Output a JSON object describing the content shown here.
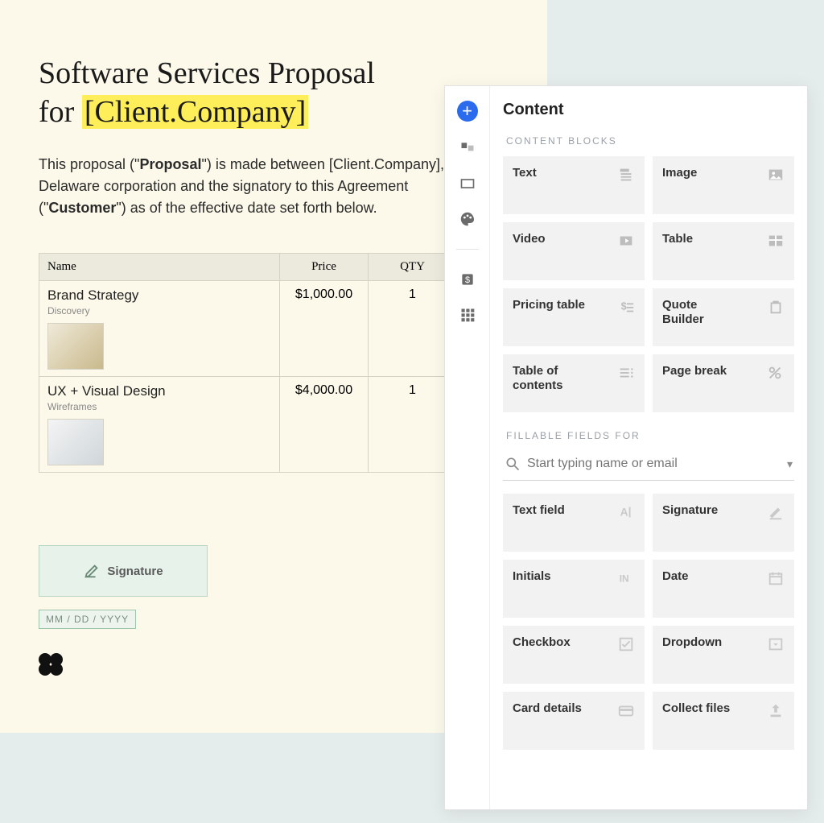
{
  "document": {
    "title_line1": "Software Services Proposal",
    "title_line2_prefix": "for ",
    "title_token": "[Client.Company]",
    "body_parts": {
      "p1a": "This proposal (\"",
      "p1b": "Proposal",
      "p1c": "\") is made between [Client.Company], a Delaware corporation and the signatory to this Agreement (\"",
      "p1d": "Customer",
      "p1e": "\") as of the effective date set forth below."
    },
    "table": {
      "headers": {
        "name": "Name",
        "price": "Price",
        "qty": "QTY"
      },
      "rows": [
        {
          "name": "Brand Strategy",
          "sub": "Discovery",
          "price": "$1,000.00",
          "qty": "1"
        },
        {
          "name": "UX + Visual Design",
          "sub": "Wireframes",
          "price": "$4,000.00",
          "qty": "1"
        }
      ]
    },
    "signature_label": "Signature",
    "date_placeholder": "MM / DD / YYYY"
  },
  "panel": {
    "title": "Content",
    "sections": {
      "blocks_label": "CONTENT BLOCKS",
      "fields_label": "FILLABLE FIELDS FOR"
    },
    "search_placeholder": "Start typing name or email",
    "content_blocks": [
      {
        "label": "Text",
        "icon": "text"
      },
      {
        "label": "Image",
        "icon": "image"
      },
      {
        "label": "Video",
        "icon": "video"
      },
      {
        "label": "Table",
        "icon": "table"
      },
      {
        "label": "Pricing table",
        "icon": "pricing"
      },
      {
        "label": "Quote Builder",
        "icon": "quote"
      },
      {
        "label": "Table of contents",
        "icon": "toc"
      },
      {
        "label": "Page break",
        "icon": "pagebreak"
      }
    ],
    "fillable_fields": [
      {
        "label": "Text field",
        "icon": "textfield"
      },
      {
        "label": "Signature",
        "icon": "signature"
      },
      {
        "label": "Initials",
        "icon": "initials"
      },
      {
        "label": "Date",
        "icon": "date"
      },
      {
        "label": "Checkbox",
        "icon": "checkbox"
      },
      {
        "label": "Dropdown",
        "icon": "dropdown"
      },
      {
        "label": "Card details",
        "icon": "card"
      },
      {
        "label": "Collect files",
        "icon": "upload"
      }
    ]
  }
}
